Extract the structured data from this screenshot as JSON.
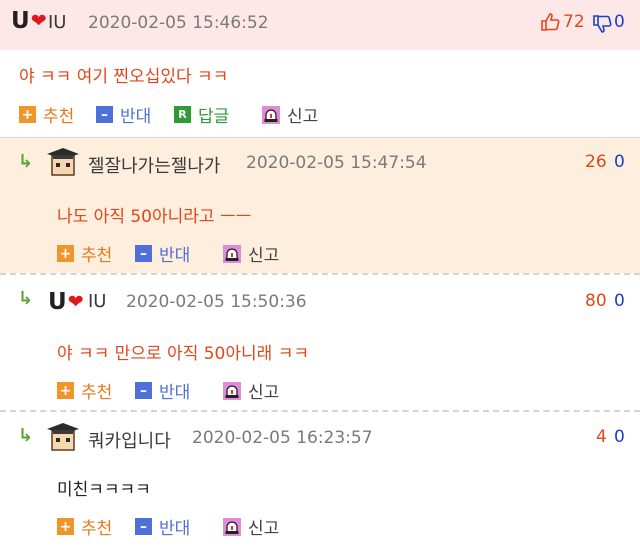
{
  "actions": {
    "recommend": "추천",
    "oppose": "반대",
    "reply": "답글",
    "report": "신고"
  },
  "comments": [
    {
      "nickname": "IU",
      "date": "2020-02-05 15:46:52",
      "text": "야 ㅋㅋ 여기 찐오십있다 ㅋㅋ",
      "up": "72",
      "down": "0",
      "avatar_icon": "u-heart-logo-icon"
    },
    {
      "nickname": "젤잘나가는젤나가",
      "date": "2020-02-05 15:47:54",
      "text": "나도 아직 50아니라고 ㅡㅡ",
      "up": "26",
      "down": "0",
      "avatar_icon": "graduate-avatar-icon"
    },
    {
      "nickname": "IU",
      "date": "2020-02-05 15:50:36",
      "text": "야 ㅋㅋ 만으로 아직 50아니래 ㅋㅋ",
      "up": "80",
      "down": "0",
      "avatar_icon": "u-heart-logo-icon"
    },
    {
      "nickname": "쿼카입니다",
      "date": "2020-02-05 16:23:57",
      "text": "미친ㅋㅋㅋㅋ",
      "up": "4",
      "down": "0",
      "avatar_icon": "graduate-avatar-icon"
    }
  ],
  "colors": {
    "highlight_bg": "#fde7e7",
    "reply_bg": "#fdeedd",
    "upvote": "#e0471a",
    "downvote": "#1740d0"
  }
}
